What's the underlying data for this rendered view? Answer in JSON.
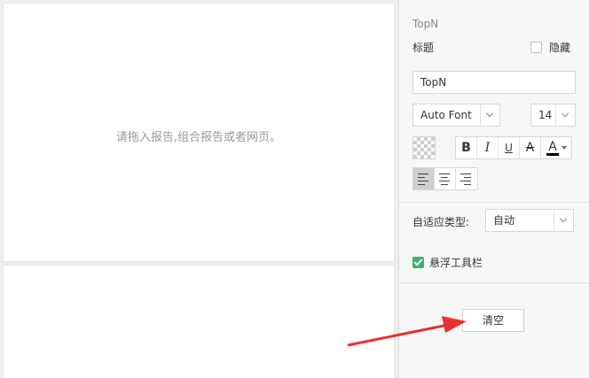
{
  "canvas": {
    "placeholder": "请拖入报告,组合报告或者网页。"
  },
  "settings": {
    "section_label": "TopN",
    "title_label": "标题",
    "hide_label": "隐藏",
    "hide_checked": false,
    "title_value": "TopN",
    "font_family": "Auto Font",
    "font_size": "14",
    "style_buttons": {
      "bold": "B",
      "italic": "I",
      "underline": "U",
      "strike": "A",
      "font_color": "A"
    },
    "font_color": "#000000",
    "alignment": [
      "left",
      "center",
      "right"
    ],
    "alignment_selected": "left",
    "adapt_label": "自适应类型:",
    "adapt_value": "自动",
    "float_toolbar_label": "悬浮工具栏",
    "float_toolbar_checked": true,
    "clear_label": "清空"
  },
  "colors": {
    "accent_check": "#3cb371",
    "annotation_arrow": "#e8312f"
  }
}
